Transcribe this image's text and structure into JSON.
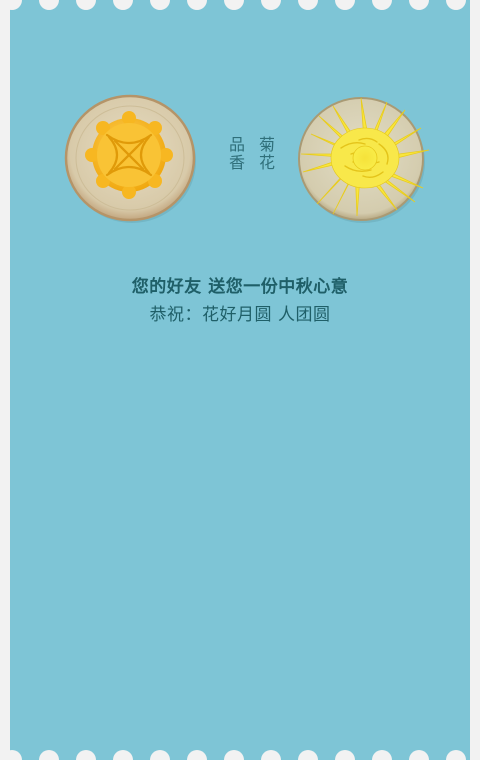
{
  "greeting": {
    "headline": "您的好友 送您一份中秋心意",
    "subline": "恭祝：花好月圆 人团圆"
  },
  "vertical_text": {
    "right_column": "菊花",
    "left_column": "品香"
  },
  "images": {
    "left_plate": "mooncake-on-plate",
    "right_plate": "chrysanthemum-on-plate"
  },
  "colors": {
    "background": "#7ec5d6",
    "text": "#1f5f68",
    "border": "#f2f2f2"
  }
}
